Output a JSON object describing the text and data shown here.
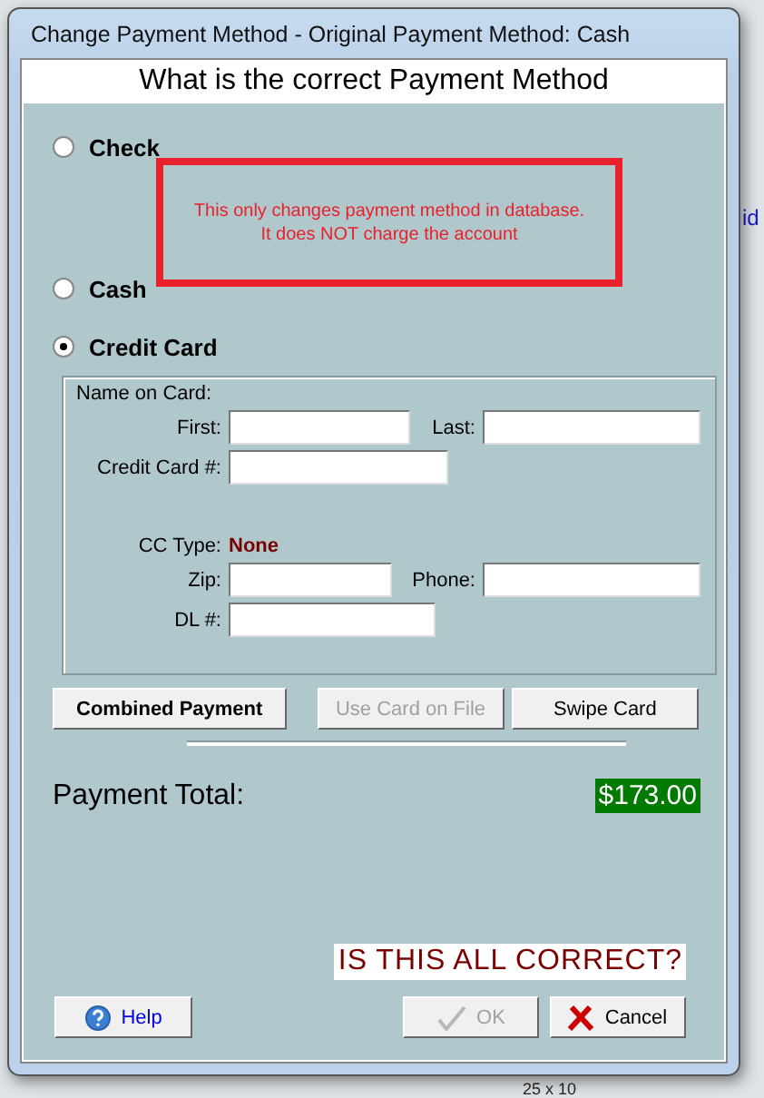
{
  "background": {
    "side_link": "id",
    "bottom_cell": "25 x 10"
  },
  "window": {
    "title": "Change Payment Method - Original Payment Method: Cash"
  },
  "header": "What is the correct Payment Method",
  "payment_methods": [
    {
      "label": "Check",
      "selected": false
    },
    {
      "label": "Cash",
      "selected": false
    },
    {
      "label": "Credit Card",
      "selected": true
    }
  ],
  "notice": [
    "This only changes payment method in database.",
    "It does NOT charge the account"
  ],
  "card_form": {
    "name_label": "Name on Card:",
    "first_label": "First:",
    "last_label": "Last:",
    "card_number_label": "Credit Card #:",
    "cc_type_label": "CC Type:",
    "cc_type_value": "None",
    "zip_label": "Zip:",
    "phone_label": "Phone:",
    "dl_label": "DL #:"
  },
  "action_buttons": [
    {
      "label": "Combined Payment",
      "bold": true,
      "disabled": false
    },
    {
      "label": "Use Card on File",
      "bold": false,
      "disabled": true
    },
    {
      "label": "Swipe Card",
      "bold": false,
      "disabled": false
    }
  ],
  "total": {
    "label": "Payment Total:",
    "value": "$173.00"
  },
  "confirm": "IS THIS ALL CORRECT?",
  "footer_buttons": [
    {
      "kind": "help",
      "label": "Help",
      "disabled": false
    },
    {
      "kind": "ok",
      "label": "OK",
      "disabled": true
    },
    {
      "kind": "cancel",
      "label": "Cancel",
      "disabled": false
    }
  ]
}
